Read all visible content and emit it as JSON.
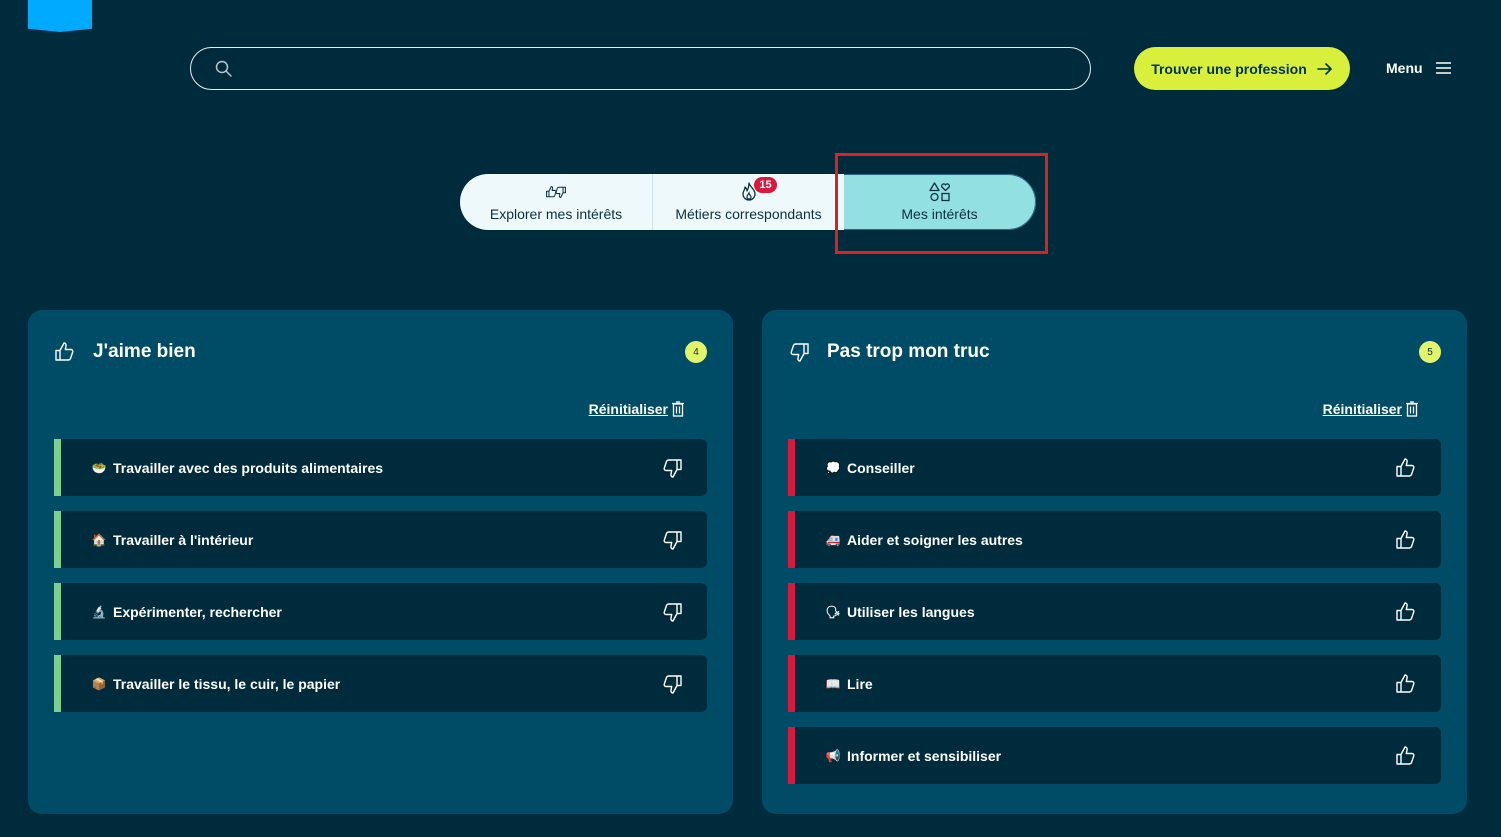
{
  "header": {
    "search": {
      "value": "",
      "placeholder": ""
    },
    "cta_label": "Trouver une profession",
    "menu_label": "Menu"
  },
  "tabs": [
    {
      "label": "Explorer mes intérêts",
      "icon": "thumbs-up-down-icon",
      "active": false
    },
    {
      "label": "Métiers correspondants",
      "icon": "flame-icon",
      "badge": "15",
      "active": false
    },
    {
      "label": "Mes intérêts",
      "icon": "shapes-heart-icon",
      "active": true
    }
  ],
  "likes": {
    "title": "J'aime bien",
    "count": "4",
    "reset_label": "Réinitialiser",
    "items": [
      {
        "emoji": "🥗",
        "label": "Travailler avec des produits alimentaires"
      },
      {
        "emoji": "🏠",
        "label": "Travailler à l'intérieur"
      },
      {
        "emoji": "🔬",
        "label": "Expérimenter, rechercher"
      },
      {
        "emoji": "📦",
        "label": "Travailler le tissu, le cuir, le papier"
      }
    ]
  },
  "dislikes": {
    "title": "Pas trop mon truc",
    "count": "5",
    "reset_label": "Réinitialiser",
    "items": [
      {
        "emoji": "💭",
        "label": "Conseiller"
      },
      {
        "emoji": "🚑",
        "label": "Aider et soigner les autres"
      },
      {
        "emoji": "🗣",
        "label": "Utiliser les langues"
      },
      {
        "emoji": "📖",
        "label": "Lire"
      },
      {
        "emoji": "📢",
        "label": "Informer et sensibiliser"
      }
    ]
  },
  "colors": {
    "background": "#002b3d",
    "panel": "#004c66",
    "accent_cta": "#d8f03c",
    "tab_active": "#93e0e2",
    "like_bar": "#7ccf8f",
    "dislike_bar": "#d6193d",
    "badge": "#d6193d"
  }
}
